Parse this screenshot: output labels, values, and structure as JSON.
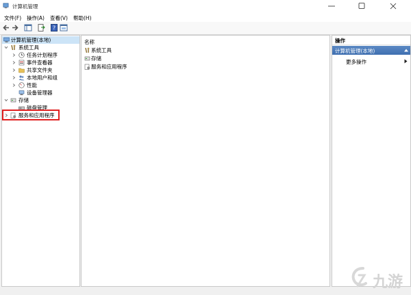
{
  "window": {
    "title": "计算机管理"
  },
  "menu": [
    "文件(F)",
    "操作(A)",
    "查看(V)",
    "帮助(H)"
  ],
  "tree": {
    "root": "计算机管理(本地)",
    "system_tools": "系统工具",
    "task_scheduler": "任务计划程序",
    "event_viewer": "事件查看器",
    "shared_folders": "共享文件夹",
    "local_users": "本地用户和组",
    "performance": "性能",
    "device_manager": "设备管理器",
    "storage": "存储",
    "disk_management": "磁盘管理",
    "services_apps": "服务和应用程序"
  },
  "content": {
    "column_header": "名称",
    "items": [
      "系统工具",
      "存储",
      "服务和应用程序"
    ]
  },
  "actions": {
    "header": "操作",
    "section": "计算机管理(本地)",
    "more": "更多操作"
  },
  "watermark": {
    "text": "九游"
  },
  "colors": {
    "selection": "#cce4f7",
    "action_section": "#4a7bbd",
    "highlight_box": "#e02020"
  }
}
